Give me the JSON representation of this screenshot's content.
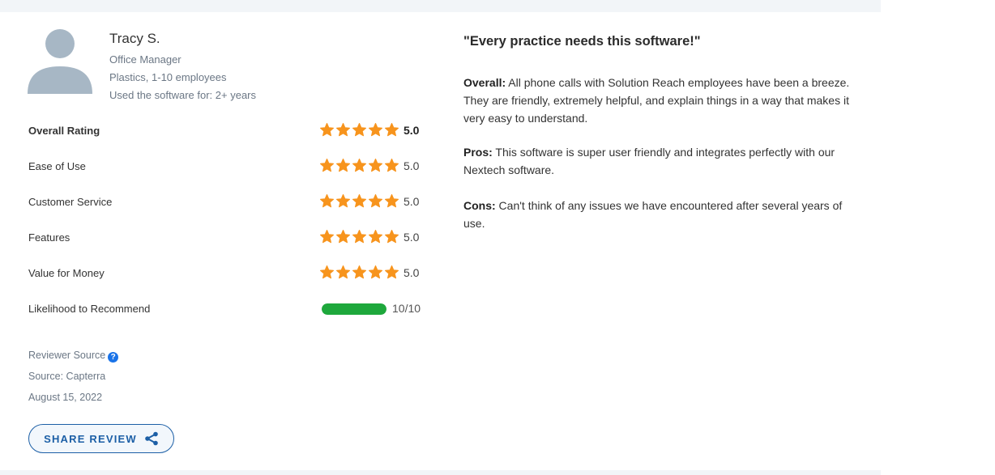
{
  "reviewer": {
    "name": "Tracy S.",
    "title": "Office Manager",
    "company": "Plastics, 1-10 employees",
    "usage": "Used the software for: 2+ years"
  },
  "ratings": [
    {
      "label": "Overall Rating",
      "value": "5.0",
      "stars": 5
    },
    {
      "label": "Ease of Use",
      "value": "5.0",
      "stars": 5
    },
    {
      "label": "Customer Service",
      "value": "5.0",
      "stars": 5
    },
    {
      "label": "Features",
      "value": "5.0",
      "stars": 5
    },
    {
      "label": "Value for Money",
      "value": "5.0",
      "stars": 5
    }
  ],
  "recommend": {
    "label": "Likelihood to Recommend",
    "value": "10/10",
    "fraction": 1.0
  },
  "source": {
    "reviewer_source_label": "Reviewer Source",
    "source": "Source: Capterra",
    "date": "August 15, 2022"
  },
  "share_button": {
    "label": "SHARE REVIEW"
  },
  "review": {
    "title": "\"Every practice needs this software!\"",
    "overall_label": "Overall:",
    "overall_text": " All phone calls with Solution Reach employees have been a breeze. They are friendly, extremely helpful, and explain things in a way that makes it very easy to understand.",
    "pros_label": "Pros:",
    "pros_text": " This software is super user friendly and integrates perfectly with our Nextech software.",
    "cons_label": "Cons:",
    "cons_text": " Can't think of any issues we have encountered after several years of use."
  },
  "colors": {
    "star": "#f7941d",
    "recommend_bar": "#1ea83c",
    "share_accent": "#1c5fa6",
    "info_icon": "#1a73e8"
  },
  "icons": [
    "user-avatar-icon",
    "star-icon",
    "info-icon",
    "share-icon"
  ]
}
